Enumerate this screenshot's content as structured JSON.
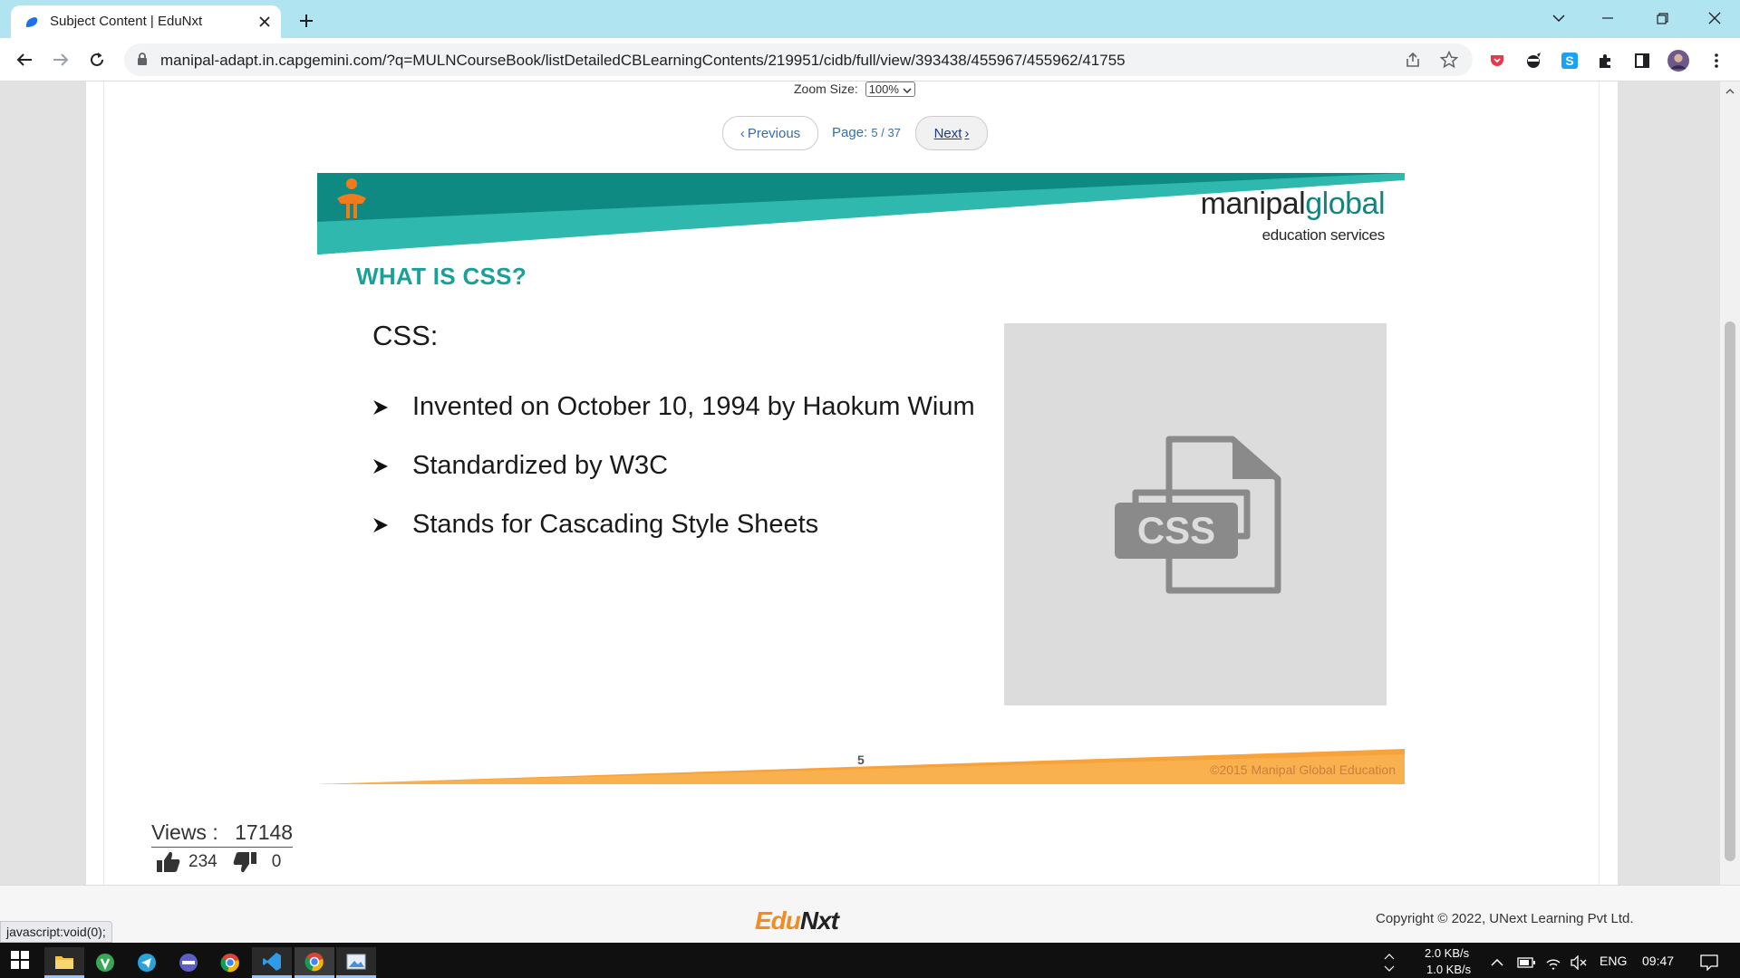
{
  "browser": {
    "tab_title": "Subject Content | EduNxt",
    "url": "manipal-adapt.in.capgemini.com/?q=MULNCourseBook/listDetailedCBLearningContents/219951/cidb/full/view/393438/455967/455962/41755",
    "status_text": "javascript:void(0);"
  },
  "viewer": {
    "zoom_label": "Zoom Size:",
    "zoom_value": "100%",
    "prev_label": "Previous",
    "next_label": "Next",
    "page_label": "Page:",
    "page_value": "5 / 37"
  },
  "slide": {
    "brand_main_a": "manipal",
    "brand_main_b": "global",
    "brand_sub": "education services",
    "title": "WHAT IS CSS?",
    "heading": "CSS:",
    "bullets": [
      "Invented on October 10, 1994 by Haokum Wium",
      "Standardized by W3C",
      "Stands for Cascading Style Sheets"
    ],
    "image_text": "CSS",
    "page_number": "5",
    "copyright": "©2015 Manipal Global Education"
  },
  "stats": {
    "views_label": "Views :",
    "views_value": "17148",
    "likes": "234",
    "dislikes": "0"
  },
  "footer": {
    "logo_a": "Edu",
    "logo_b": "Nxt",
    "copyright": "Copyright © 2022, UNext Learning Pvt Ltd."
  },
  "taskbar": {
    "net_up": "2.0 KB/s",
    "net_down": "1.0 KB/s",
    "language": "ENG",
    "clock": "09:47"
  },
  "colors": {
    "teal_dark": "#0e8a82",
    "teal_light": "#2fb8ae",
    "orange": "#f7a33a",
    "link_blue": "#3a6ea5",
    "tab_strip": "#b0e4f0"
  }
}
